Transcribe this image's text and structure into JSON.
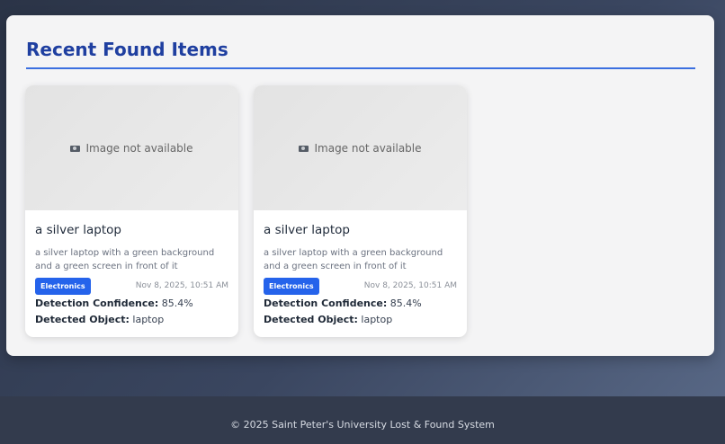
{
  "section": {
    "title": "Recent Found Items"
  },
  "items": [
    {
      "image_placeholder": "Image not available",
      "title": "a silver laptop",
      "description": "a silver laptop with a green background and a green screen in front of it",
      "category": "Electronics",
      "date": "Nov 8, 2025, 10:51 AM",
      "confidence_label": "Detection Confidence:",
      "confidence_value": "85.4%",
      "object_label": "Detected Object:",
      "object_value": "laptop"
    },
    {
      "image_placeholder": "Image not available",
      "title": "a silver laptop",
      "description": "a silver laptop with a green background and a green screen in front of it",
      "category": "Electronics",
      "date": "Nov 8, 2025, 10:51 AM",
      "confidence_label": "Detection Confidence:",
      "confidence_value": "85.4%",
      "object_label": "Detected Object:",
      "object_value": "laptop"
    }
  ],
  "footer": {
    "text": "© 2025 Saint Peter's University Lost & Found System"
  },
  "colors": {
    "accent": "#2563eb",
    "title": "#1f3fa0"
  }
}
